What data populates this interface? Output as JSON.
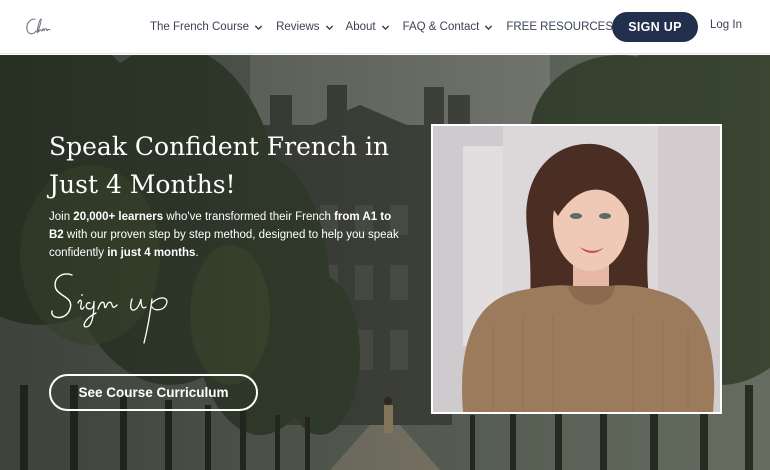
{
  "nav": {
    "logo_text": "Clm",
    "items": [
      {
        "label": "The French Course",
        "icon": "chevron-down-icon"
      },
      {
        "label": "Reviews",
        "icon": "chevron-down-icon"
      },
      {
        "label": "About",
        "icon": "chevron-down-icon"
      },
      {
        "label": "FAQ & Contact",
        "icon": "chevron-down-icon"
      },
      {
        "label": "FREE RESOURCES",
        "icon": "chevron-down-icon"
      }
    ],
    "signup_label": "SIGN UP",
    "login_label": "Log In"
  },
  "hero": {
    "headline": "Speak Confident French in Just 4 Months!",
    "sub": {
      "p1": "Join ",
      "b1": "20,000+ learners",
      "p2": " who've transformed their French ",
      "b2": "from A1 to B2",
      "p3": " with our proven step by step method, designed to help you speak confidently ",
      "b3": "in just 4 months",
      "p4": "."
    },
    "signature_text": "Sign up",
    "cta_label": "See Course Curriculum"
  },
  "colors": {
    "nav_text": "#3b4256",
    "signup_bg": "#23304d",
    "hero_text": "#ffffff"
  }
}
